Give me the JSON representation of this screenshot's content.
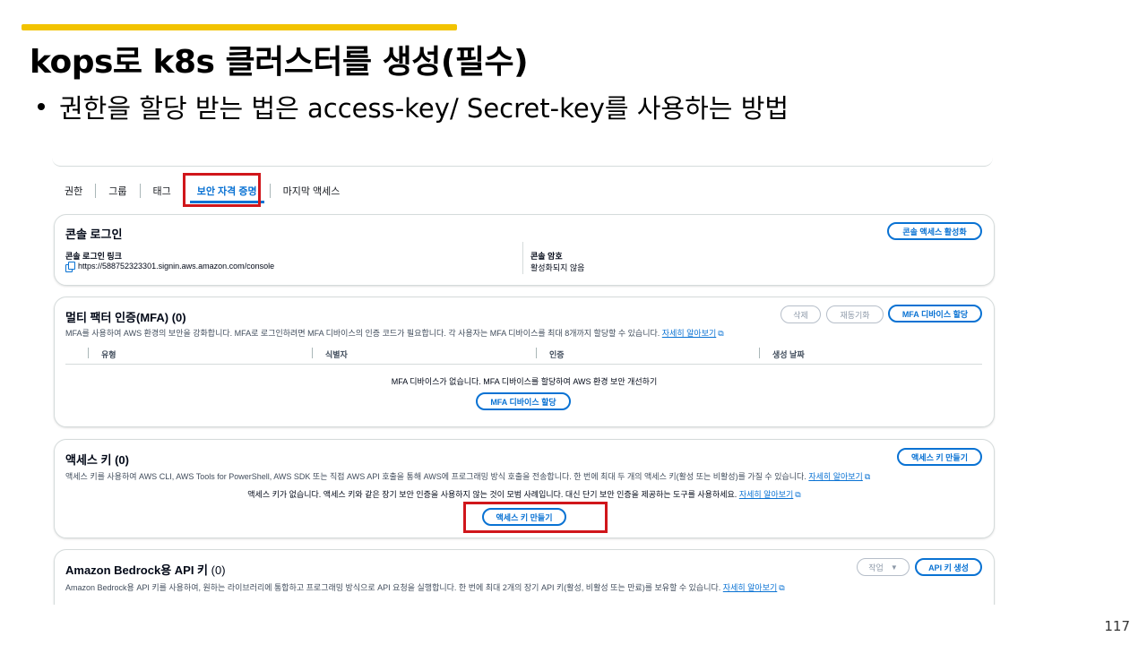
{
  "slide": {
    "title": "kops로 k8s 클러스터를 생성(필수)",
    "bullet": "권한을 할당 받는 법은 access-key/ Secret-key를 사용하는 방법",
    "page_number": "117"
  },
  "colors": {
    "accent": "#f2c300",
    "link": "#0972d3",
    "highlight": "#d0161b"
  },
  "tabs": [
    {
      "label": "권한"
    },
    {
      "label": "그룹"
    },
    {
      "label": "태그"
    },
    {
      "label": "보안 자격 증명",
      "active": true
    },
    {
      "label": "마지막 액세스"
    }
  ],
  "console": {
    "title": "콘솔 로그인",
    "button": "콘솔 액세스 활성화",
    "link_label": "콘솔 로그인 링크",
    "link_value": "https://588752323301.signin.aws.amazon.com/console",
    "password_label": "콘솔 암호",
    "password_value": "활성화되지 않음"
  },
  "mfa": {
    "title": "멀티 팩터 인증(MFA)",
    "count": "(0)",
    "description": "MFA를 사용하여 AWS 환경의 보안을 강화합니다. MFA로 로그인하려면 MFA 디바이스의 인증 코드가 필요합니다. 각 사용자는 MFA 디바이스를 최대 8개까지 할당할 수 있습니다.",
    "learn_more": "자세히 알아보기",
    "buttons": {
      "delete": "삭제",
      "resync": "재동기화",
      "assign": "MFA 디바이스 할당"
    },
    "columns": [
      "유형",
      "식별자",
      "인증",
      "생성 날짜"
    ],
    "empty_message": "MFA 디바이스가 없습니다. MFA 디바이스를 할당하여 AWS 환경 보안 개선하기",
    "empty_button": "MFA 디바이스 할당"
  },
  "access_keys": {
    "title": "액세스 키",
    "count": "(0)",
    "description": "액세스 키를 사용하여 AWS CLI, AWS Tools for PowerShell, AWS SDK 또는 직접 AWS API 호출을 통해 AWS에 프로그래밍 방식 호출을 전송합니다. 한 번에 최대 두 개의 액세스 키(활성 또는 비활성)를 가질 수 있습니다.",
    "learn_more": "자세히 알아보기",
    "button": "액세스 키 만들기",
    "empty_message": "액세스 키가 없습니다. 액세스 키와 같은 장기 보안 인증을 사용하지 않는 것이 모범 사례입니다. 대신 단기 보안 인증을 제공하는 도구를 사용하세요.",
    "empty_link": "자세히 알아보기",
    "empty_button": "액세스 키 만들기"
  },
  "bedrock": {
    "title": "Amazon Bedrock용 API 키",
    "count": "(0)",
    "description": "Amazon Bedrock용 API 키를 사용하여, 원하는 라이브러리에 통합하고 프로그래밍 방식으로 API 요청을 실행합니다. 한 번에 최대 2개의 장기 API 키(활성, 비활성 또는 만료)를 보유할 수 있습니다.",
    "learn_more": "자세히 알아보기",
    "actions": "작업",
    "button": "API 키 생성"
  }
}
